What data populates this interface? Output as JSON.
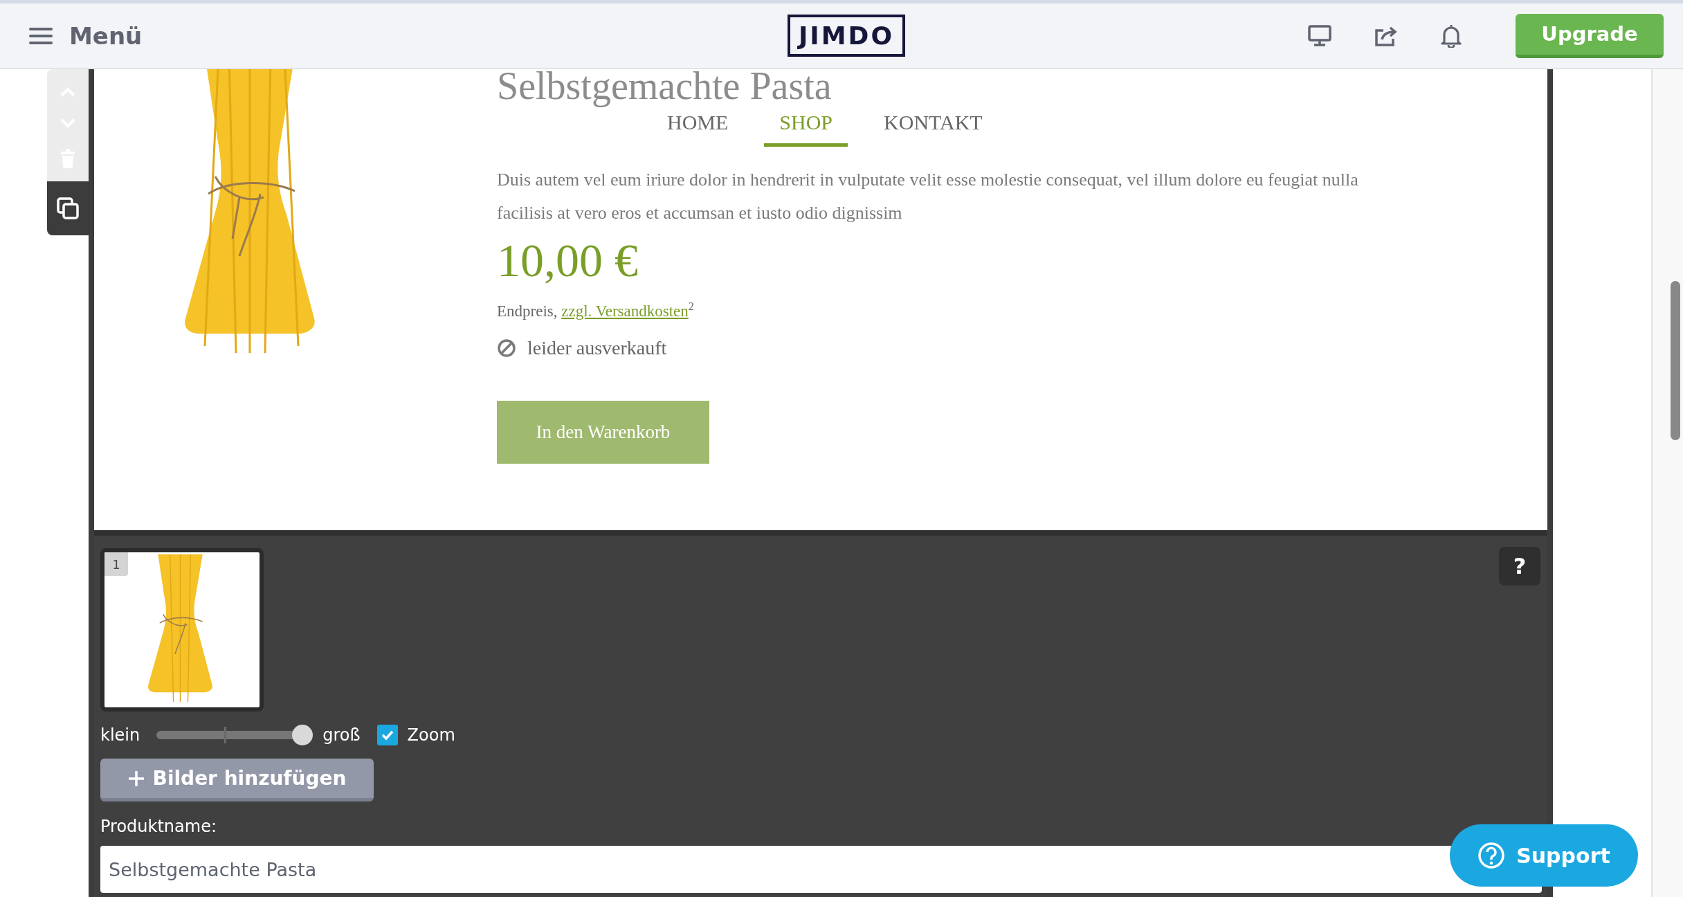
{
  "topbar": {
    "menu_label": "Menü",
    "logo": "JIMDO",
    "upgrade_button": "Upgrade"
  },
  "site": {
    "nav": [
      {
        "label": "HOME",
        "selected": false
      },
      {
        "label": "SHOP",
        "selected": true
      },
      {
        "label": "KONTAKT",
        "selected": false
      }
    ],
    "product": {
      "title": "Selbstgemachte Pasta",
      "description": "Duis autem vel eum iriure dolor in hendrerit in vulputate velit esse molestie consequat, vel illum dolore eu feugiat nulla facilisis at vero eros et accumsan et iusto odio dignissim",
      "price": "10,00 €",
      "price_note": "Endpreis,",
      "shipping_link": "zzgl. Versandkosten",
      "footnote": "$^{2}$",
      "availability": "leider ausverkauft",
      "cart_button": {
        "label": "In den Warenkorb",
        "disabled": true
      }
    }
  },
  "editor": {
    "image_number": "1",
    "size_min_label": "klein",
    "size_max_label": "groß",
    "size_slider": {
      "level": 1.0
    },
    "zoom": {
      "label": "Zoom",
      "checked": true
    },
    "add_images_button": "Bilder hinzufügen",
    "product_name": {
      "label": "Produktname:",
      "value": "Selbstgemachte Pasta"
    },
    "help_button": "?"
  },
  "support_button": "Support"
}
